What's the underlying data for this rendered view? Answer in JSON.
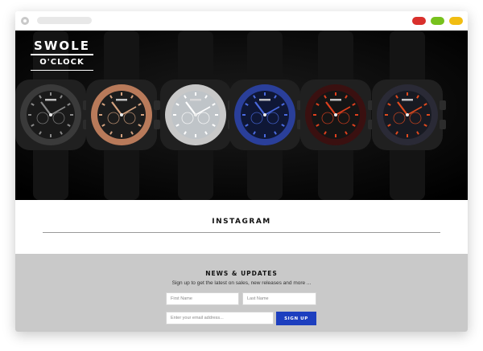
{
  "browser": {
    "controls": [
      "settings-icon",
      "close-icon",
      "maximize-icon",
      "minimize-icon"
    ],
    "colors": {
      "close": "#d9302c",
      "maximize": "#77c11d",
      "minimize": "#f1bd12"
    }
  },
  "brand": {
    "line1": "SWOLE",
    "line2": "O'CLOCK"
  },
  "hero": {
    "watches": [
      {
        "bezel": "#3a3a3a",
        "dial": "#1a1a1a",
        "accent": "#8a8a8a"
      },
      {
        "bezel": "#b87a5a",
        "dial": "#1c1c1c",
        "accent": "#d4a27f"
      },
      {
        "bezel": "#c8c8c8",
        "dial": "#bfc4c8",
        "accent": "#ffffff"
      },
      {
        "bezel": "#2a3f9a",
        "dial": "#0f1736",
        "accent": "#4a6ae0"
      },
      {
        "bezel": "#3a1010",
        "dial": "#151515",
        "accent": "#e0401e"
      },
      {
        "bezel": "#2a2a36",
        "dial": "#181a22",
        "accent": "#e04a1e"
      }
    ]
  },
  "instagram": {
    "title": "INSTAGRAM"
  },
  "newsletter": {
    "title": "NEWS & UPDATES",
    "subtitle": "Sign up to get the latest on sales, new releases and more ...",
    "first_name_placeholder": "First Name",
    "last_name_placeholder": "Last Name",
    "email_placeholder": "Enter your email address...",
    "button_label": "SIGN UP",
    "button_color": "#1d3fbf"
  }
}
